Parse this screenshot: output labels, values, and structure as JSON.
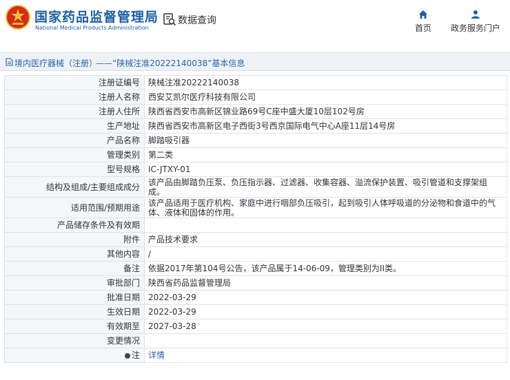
{
  "header": {
    "site_title": "国家药品监督管理局",
    "site_subtitle": "National Medical Products Administration",
    "query_label": "数据查询",
    "nav": [
      {
        "label": "首页",
        "icon": "home-icon"
      },
      {
        "label": "政务服务门户",
        "icon": "user-icon"
      }
    ]
  },
  "breadcrumb": {
    "link": "境内医疗器械（注册）",
    "title": "——“陕械注准20222140038”基本信息"
  },
  "rows": [
    {
      "label": "注册证编号",
      "value": "陕械注准20222140038"
    },
    {
      "label": "注册人名称",
      "value": "西安艾凯尔医疗科技有限公司"
    },
    {
      "label": "注册人住所",
      "value": "陕西省西安市高新区锦业路69号C座中盛大厦10层102号房"
    },
    {
      "label": "生产地址",
      "value": "陕西省西安市高新区电子西街3号西京国际电气中心A座11层14号房"
    },
    {
      "label": "产品名称",
      "value": "脚踏吸引器"
    },
    {
      "label": "管理类别",
      "value": "第二类"
    },
    {
      "label": "型号规格",
      "value": "IC-JTXY-01"
    },
    {
      "label": "结构及组成/主要组成成分",
      "value": "该产品由脚踏负压泵、负压指示器、过滤器、收集容器、溢流保护装置、吸引管道和支撑架组成。"
    },
    {
      "label": "适用范围/预期用途",
      "value": "该产品适用于医疗机构、家庭中进行咽部负压吸引，起到吸引人体呼吸道的分泌物和食道中的气体、液体和固体的作用。"
    },
    {
      "label": "产品储存条件及有效期",
      "value": ""
    },
    {
      "label": "附件",
      "value": "产品技术要求"
    },
    {
      "label": "其他内容",
      "value": "/"
    },
    {
      "label": "备注",
      "value": "依据2017年第104号公告，该产品属于14-06-09，管理类别为II类。"
    },
    {
      "label": "审批部门",
      "value": "陕西省药品监督管理局"
    },
    {
      "label": "批准日期",
      "value": "2022-03-29"
    },
    {
      "label": "生效日期",
      "value": "2022-03-29"
    },
    {
      "label": "有效期至",
      "value": "2027-03-28"
    },
    {
      "label": "变更情况",
      "value": ""
    }
  ],
  "note": {
    "label": "注",
    "link": "详情"
  },
  "colors": {
    "brand_blue": "#1b5fa8",
    "link_blue": "#2b64ad",
    "emblem_red": "#d62a1e",
    "emblem_gold": "#f2c230"
  }
}
